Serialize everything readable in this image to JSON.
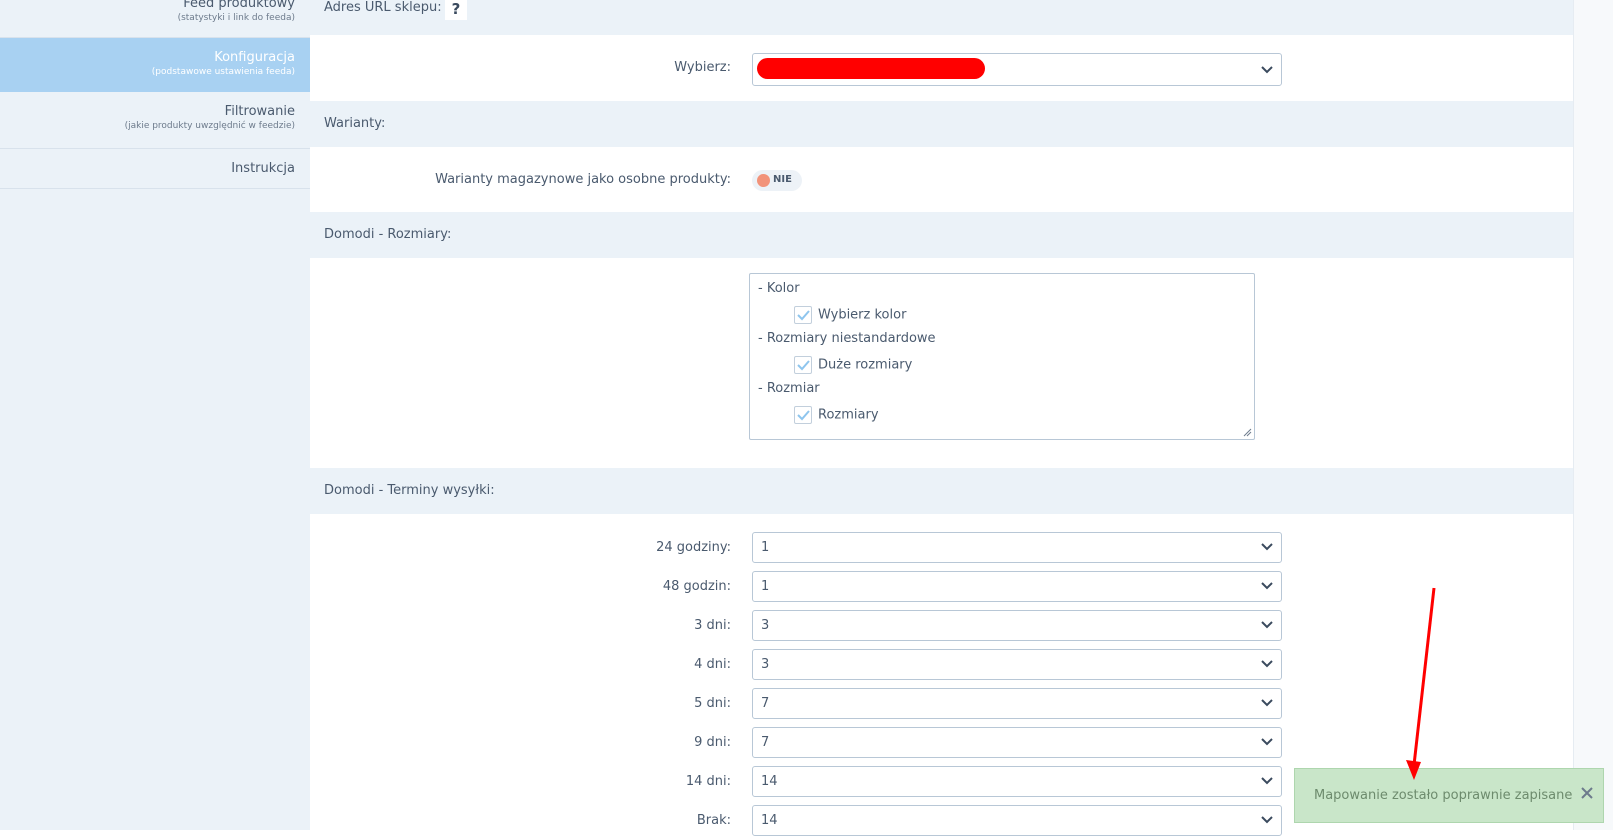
{
  "sidebar": {
    "items": [
      {
        "title": "Feed produktowy",
        "subtitle": "(statystyki i link do feeda)"
      },
      {
        "title": "Konfiguracja",
        "subtitle": "(podstawowe ustawienia feeda)"
      },
      {
        "title": "Filtrowanie",
        "subtitle": "(jakie produkty uwzględnić w feedzie)"
      },
      {
        "title": "Instrukcja",
        "subtitle": ""
      }
    ]
  },
  "shop_url": {
    "label": "Adres URL sklepu:",
    "help": "?"
  },
  "select_shop": {
    "label": "Wybierz:",
    "value": "",
    "note": "value redacted with red marker"
  },
  "variants": {
    "heading": "Warianty:",
    "label": "Warianty magazynowe jako osobne produkty:",
    "toggle_value": "NIE",
    "toggle_color": "#f2937a"
  },
  "sizes": {
    "heading": "Domodi - Rozmiary:",
    "groups": [
      {
        "name": "- Kolor",
        "option": "Wybierz kolor",
        "checked": true
      },
      {
        "name": "- Rozmiary niestandardowe",
        "option": "Duże rozmiary",
        "checked": true
      },
      {
        "name": "- Rozmiar",
        "option": "Rozmiary",
        "checked": true
      }
    ]
  },
  "shipping": {
    "heading": "Domodi - Terminy wysyłki:",
    "rows": [
      {
        "label": "24 godziny:",
        "value": "1"
      },
      {
        "label": "48 godzin:",
        "value": "1"
      },
      {
        "label": "3 dni:",
        "value": "3"
      },
      {
        "label": "4 dni:",
        "value": "3"
      },
      {
        "label": "5 dni:",
        "value": "7"
      },
      {
        "label": "9 dni:",
        "value": "7"
      },
      {
        "label": "14 dni:",
        "value": "14"
      },
      {
        "label": "Brak:",
        "value": "14"
      }
    ]
  },
  "toast": {
    "message": "Mapowanie zostało poprawnie zapisane",
    "close": "✕"
  },
  "colors": {
    "accent": "#a8d1f2",
    "annotation": "#ff0000",
    "toast_bg": "#c9e6c9"
  }
}
